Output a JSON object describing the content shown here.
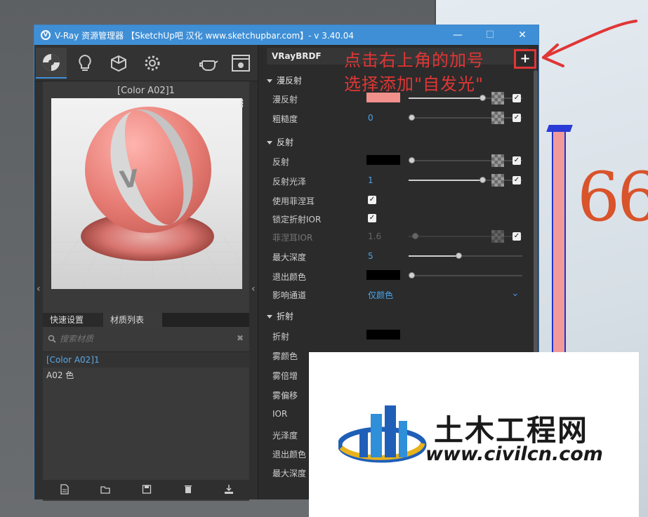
{
  "window": {
    "title": "V-Ray 资源管理器 【SketchUp吧 汉化 www.sketchupbar.com】- v 3.40.04",
    "min_icon": "minimize-icon",
    "max_icon": "maximize-icon",
    "close_icon": "close-icon"
  },
  "toolbar": {
    "items": [
      "materials-icon",
      "lights-icon",
      "geometry-icon",
      "settings-icon",
      "render-teapot-icon",
      "render-window-icon"
    ]
  },
  "preview": {
    "title": "[Color A02]1"
  },
  "tabs": [
    {
      "label": "快速设置"
    },
    {
      "label": "材质列表"
    }
  ],
  "search": {
    "placeholder": "搜索材质"
  },
  "material_list": [
    {
      "label": "[Color A02]1",
      "selected": true
    },
    {
      "label": "A02 色",
      "selected": false
    }
  ],
  "right_panel": {
    "header": "VRayBRDF",
    "sections": {
      "diffuse": {
        "title": "漫反射",
        "rows": [
          {
            "label": "漫反射",
            "color": "#f2918c",
            "slider": 1.0
          },
          {
            "label": "粗糙度",
            "value": "0",
            "slider": 0.0
          }
        ]
      },
      "reflection": {
        "title": "反射",
        "rows": [
          {
            "label": "反射",
            "color": "#000000",
            "slider": 0.0
          },
          {
            "label": "反射光泽",
            "value": "1",
            "slider": 1.0
          },
          {
            "label": "使用菲涅耳",
            "checked": true
          },
          {
            "label": "锁定折射IOR",
            "checked": true
          },
          {
            "label": "菲涅耳IOR",
            "value": "1.6",
            "disabled": true
          },
          {
            "label": "最大深度",
            "value": "5",
            "slider": 0.45
          },
          {
            "label": "退出颜色",
            "color": "#000000",
            "slider": 0.0
          },
          {
            "label": "影响通道",
            "value": "仅颜色"
          }
        ]
      },
      "refraction": {
        "title": "折射",
        "rows": [
          {
            "label": "折射"
          },
          {
            "label": "雾颜色"
          },
          {
            "label": "雾倍增"
          },
          {
            "label": "雾偏移"
          },
          {
            "label": "IOR"
          },
          {
            "label": "光泽度"
          },
          {
            "label": "退出颜色"
          },
          {
            "label": "最大深度"
          }
        ]
      }
    },
    "add_label": "+"
  },
  "annotation": {
    "line1": "点击右上角的加号",
    "line2": "选择添加\"自发光\"",
    "color": "#e03636"
  },
  "scene": {
    "number": "66"
  },
  "watermark": {
    "title": "土木工程网",
    "url": "www.civilcn.com"
  },
  "footer_icons": [
    "new-file-icon",
    "open-folder-icon",
    "save-icon",
    "delete-icon",
    "import-icon"
  ]
}
